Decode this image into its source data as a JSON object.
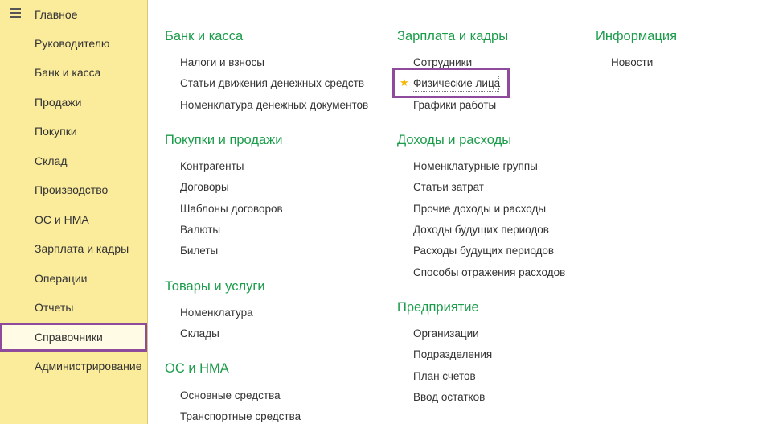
{
  "sidebar": {
    "menu_icon": "hamburger-menu-icon",
    "items": [
      {
        "label": "Главное"
      },
      {
        "label": "Руководителю"
      },
      {
        "label": "Банк и касса"
      },
      {
        "label": "Продажи"
      },
      {
        "label": "Покупки"
      },
      {
        "label": "Склад"
      },
      {
        "label": "Производство"
      },
      {
        "label": "ОС и НМА"
      },
      {
        "label": "Зарплата и кадры"
      },
      {
        "label": "Операции"
      },
      {
        "label": "Отчеты"
      },
      {
        "label": "Справочники"
      },
      {
        "label": "Администрирование"
      }
    ],
    "active": "Справочники"
  },
  "sections": {
    "bank": {
      "title": "Банк и касса",
      "links": [
        "Налоги и взносы",
        "Статьи движения денежных средств",
        "Номенклатура денежных документов"
      ]
    },
    "sales": {
      "title": "Покупки и продажи",
      "links": [
        "Контрагенты",
        "Договоры",
        "Шаблоны договоров",
        "Валюты",
        "Билеты"
      ]
    },
    "goods": {
      "title": "Товары и услуги",
      "links": [
        "Номенклатура",
        "Склады"
      ]
    },
    "os": {
      "title": "ОС и НМА",
      "links": [
        "Основные средства",
        "Транспортные средства"
      ]
    },
    "salary": {
      "title": "Зарплата и кадры",
      "links": [
        "Сотрудники",
        "Физические лица",
        "Графики работы"
      ],
      "favorite": "Физические лица"
    },
    "income": {
      "title": "Доходы и расходы",
      "links": [
        "Номенклатурные группы",
        "Статьи затрат",
        "Прочие доходы и расходы",
        "Доходы будущих периодов",
        "Расходы будущих периодов",
        "Способы отражения расходов"
      ]
    },
    "enterprise": {
      "title": "Предприятие",
      "links": [
        "Организации",
        "Подразделения",
        "План счетов",
        "Ввод остатков"
      ]
    },
    "info": {
      "title": "Информация",
      "links": [
        "Новости"
      ]
    }
  },
  "colors": {
    "sidebar_bg": "#fbec9c",
    "section_title": "#1b9c4a",
    "highlight_border": "#8e4b9c",
    "favorite_star": "#f4b400"
  }
}
